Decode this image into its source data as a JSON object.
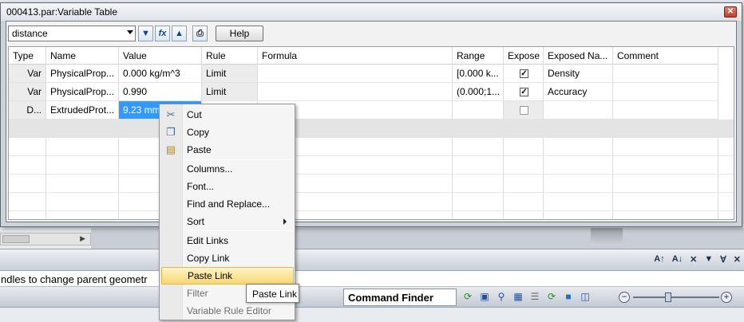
{
  "window": {
    "title": "000413.par:Variable Table"
  },
  "toolbar": {
    "filter_value": "distance",
    "help_label": "Help",
    "icons": [
      "filter-icon",
      "formula-icon",
      "variable-filter-icon",
      "print-icon"
    ]
  },
  "table": {
    "headers": [
      "Type",
      "Name",
      "Value",
      "Rule",
      "Formula",
      "Range",
      "Expose",
      "Exposed Na...",
      "Comment"
    ],
    "rows": [
      {
        "type": "Var",
        "name": "PhysicalProp...",
        "value": "0.000 kg/m^3",
        "rule": "Limit",
        "formula": "",
        "range": "[0.000 k...",
        "expose": true,
        "exposed_name": "Density",
        "comment": ""
      },
      {
        "type": "Var",
        "name": "PhysicalProp...",
        "value": "0.990",
        "rule": "Limit",
        "formula": "",
        "range": "(0.000;1...",
        "expose": true,
        "exposed_name": "Accuracy",
        "comment": ""
      },
      {
        "type": "D...",
        "name": "ExtrudedProt...",
        "value": "9.23 mm",
        "rule": "",
        "formula": "",
        "range": "",
        "expose": false,
        "exposed_name": "",
        "comment": ""
      }
    ]
  },
  "context_menu": {
    "items": [
      "Cut",
      "Copy",
      "Paste",
      "Columns...",
      "Font...",
      "Find and Replace...",
      "Sort",
      "Edit Links",
      "Copy Link",
      "Paste Link",
      "Filter",
      "Variable Rule Editor"
    ],
    "highlighted": "Paste Link",
    "tooltip": "Paste Link"
  },
  "background": {
    "prompt_text": "ndles to change parent geometr",
    "command_finder": "Command Finder"
  },
  "colors": {
    "selection": "#3399ff",
    "menu_highlight": "#f7d772",
    "close_button": "#c0402c"
  }
}
